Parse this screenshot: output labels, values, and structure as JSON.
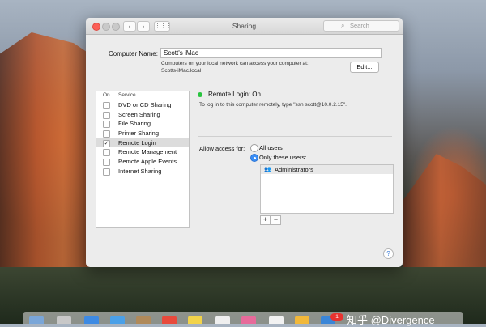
{
  "window": {
    "title": "Sharing",
    "search_placeholder": "Search",
    "back_icon": "‹",
    "forward_icon": "›",
    "show_all_icon": "⋮⋮⋮"
  },
  "computer": {
    "label": "Computer Name:",
    "name": "Scott's iMac",
    "desc_line1": "Computers on your local network can access your computer at:",
    "desc_line2": "Scotts-iMac.local",
    "edit_label": "Edit..."
  },
  "services": {
    "col_on": "On",
    "col_service": "Service",
    "items": [
      {
        "label": "DVD or CD Sharing",
        "on": false
      },
      {
        "label": "Screen Sharing",
        "on": false
      },
      {
        "label": "File Sharing",
        "on": false
      },
      {
        "label": "Printer Sharing",
        "on": false
      },
      {
        "label": "Remote Login",
        "on": true,
        "selected": true
      },
      {
        "label": "Remote Management",
        "on": false
      },
      {
        "label": "Remote Apple Events",
        "on": false
      },
      {
        "label": "Internet Sharing",
        "on": false
      }
    ]
  },
  "detail": {
    "status": "Remote Login: On",
    "status_color": "#29c43f",
    "instructions": "To log in to this computer remotely, type \"ssh scott@10.0.2.15\".",
    "allow_label": "Allow access for:",
    "option_all": "All users",
    "option_only": "Only these users:",
    "selected_option": "Only these users:",
    "users": [
      "Administrators"
    ],
    "add_label": "+",
    "remove_label": "−"
  },
  "help_label": "?",
  "dock": {
    "badge": "1",
    "watermark": "知乎 @Divergence"
  }
}
